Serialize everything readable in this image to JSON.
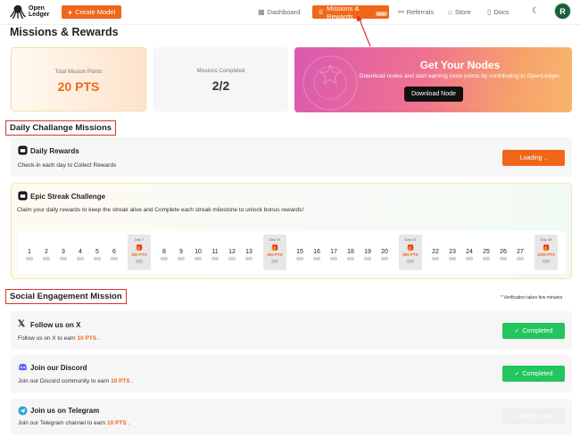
{
  "header": {
    "logo_line1": "Open",
    "logo_line2": "Ledger",
    "create_label": "Create Model",
    "nav": {
      "dashboard": "Dashboard",
      "missions": "Missions & Rewards",
      "referrals": "Referrals",
      "store": "Store",
      "docs": "Docs"
    },
    "avatar_initial": "R"
  },
  "page": {
    "title": "Missions & Rewards"
  },
  "stats": {
    "total_label": "Total Mission Points",
    "total_value": "20 PTS",
    "completed_label": "Missions Completed",
    "completed_value": "2/2"
  },
  "promo": {
    "title": "Get Your Nodes",
    "subtitle": "Download nodes and start earning more points by contributing to OpenLedger.",
    "button": "Download Node"
  },
  "daily": {
    "section_title": "Daily Challange Missions",
    "rewards_title": "Daily Rewards",
    "rewards_desc": "Check-in each day to Collect Rewards",
    "rewards_button": "Loading ..",
    "streak_title": "Epic Streak Challenge",
    "streak_desc": "Claim your daily rewards to keep the streak alive and Complete each streak milestone to unlock bonus rewards!",
    "days": [
      "1",
      "2",
      "3",
      "4",
      "5",
      "6",
      "8",
      "9",
      "10",
      "11",
      "12",
      "13",
      "15",
      "16",
      "17",
      "18",
      "19",
      "20",
      "22",
      "23",
      "24",
      "25",
      "26",
      "27"
    ],
    "milestones": [
      {
        "label": "Day 7",
        "pts": "200 PTS"
      },
      {
        "label": "Day 14",
        "pts": "400 PTS"
      },
      {
        "label": "Day 21",
        "pts": "800 PTS"
      },
      {
        "label": "Day 28",
        "pts": "1000 PTS"
      }
    ]
  },
  "social": {
    "section_title": "Social Engagement Mission",
    "verify_note": "* Verification takes few minutes",
    "x_title": "Follow us on X",
    "x_desc_pre": "Follow us on X to earn",
    "x_pts": "10 PTS",
    "x_desc_post": ".",
    "x_button": "Completed",
    "discord_title": "Join our Discord",
    "discord_desc_pre": "Join our Discord community to earn",
    "discord_pts": "10 PTS",
    "discord_desc_post": ".",
    "discord_button": "Completed",
    "telegram_title": "Join us on Telegram",
    "telegram_desc_pre": "Join our Telegram channel to earn",
    "telegram_pts": "10 PTS",
    "telegram_desc_post": ".",
    "telegram_button": "Coming soon"
  },
  "colors": {
    "accent": "#f0671a",
    "success": "#22c55e",
    "highlight_box": "#d9332c"
  }
}
